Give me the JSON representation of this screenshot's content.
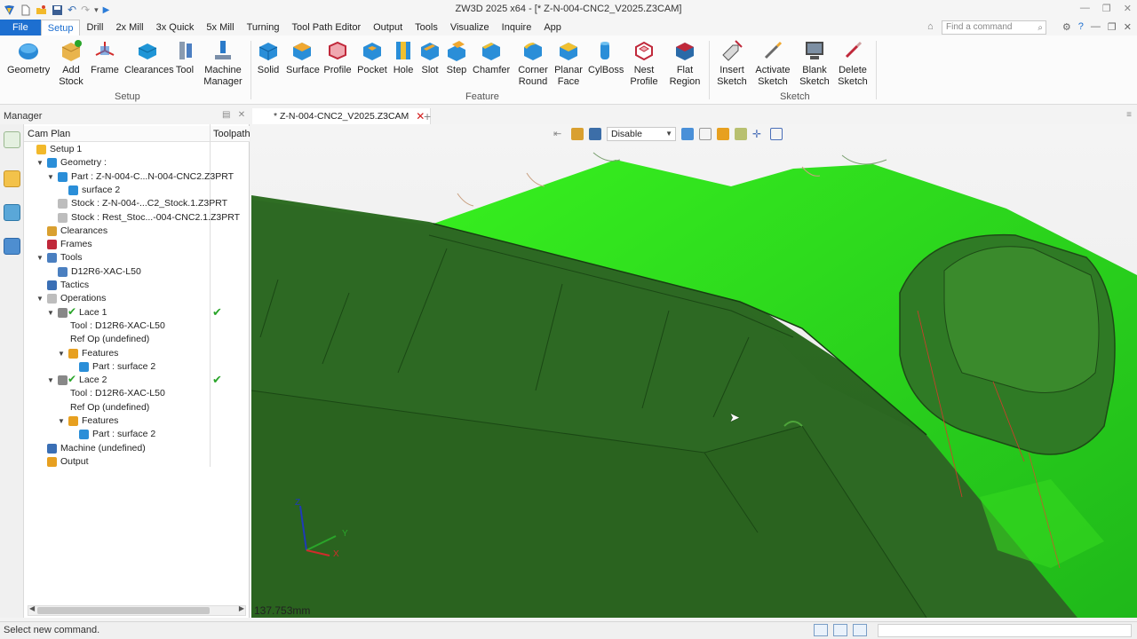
{
  "window": {
    "title": "ZW3D 2025 x64 - [* Z-N-004-CNC2_V2025.Z3CAM]"
  },
  "menubar": {
    "items": [
      "File",
      "Setup",
      "Drill",
      "2x Mill",
      "3x Quick",
      "5x Mill",
      "Turning",
      "Tool Path Editor",
      "Output",
      "Tools",
      "Visualize",
      "Inquire",
      "App"
    ],
    "active": "Setup",
    "search_placeholder": "Find a command"
  },
  "ribbon": {
    "setup_buttons": [
      {
        "label": "Geometry",
        "icon": "geometry-icon"
      },
      {
        "label": "Add\nStock",
        "icon": "add-stock-icon"
      },
      {
        "label": "Frame",
        "icon": "frame-icon"
      },
      {
        "label": "Clearances",
        "icon": "clearances-icon"
      },
      {
        "label": "Tool",
        "icon": "tool-icon"
      },
      {
        "label": "Machine\nManager",
        "icon": "machine-manager-icon"
      }
    ],
    "setup_group": "Setup",
    "feature_buttons": [
      {
        "label": "Solid",
        "icon": "solid-icon"
      },
      {
        "label": "Surface",
        "icon": "surface-icon"
      },
      {
        "label": "Profile",
        "icon": "profile-icon"
      },
      {
        "label": "Pocket",
        "icon": "pocket-icon"
      },
      {
        "label": "Hole",
        "icon": "hole-icon"
      },
      {
        "label": "Slot",
        "icon": "slot-icon"
      },
      {
        "label": "Step",
        "icon": "step-icon"
      },
      {
        "label": "Chamfer",
        "icon": "chamfer-icon"
      },
      {
        "label": "Corner\nRound",
        "icon": "corner-round-icon"
      },
      {
        "label": "Planar\nFace",
        "icon": "planar-face-icon"
      },
      {
        "label": "CylBoss",
        "icon": "cylboss-icon"
      },
      {
        "label": "Nest\nProfile",
        "icon": "nest-profile-icon"
      },
      {
        "label": "Flat\nRegion",
        "icon": "flat-region-icon"
      }
    ],
    "feature_group": "Feature",
    "sketch_buttons": [
      {
        "label": "Insert\nSketch",
        "icon": "insert-sketch-icon"
      },
      {
        "label": "Activate\nSketch",
        "icon": "activate-sketch-icon"
      },
      {
        "label": "Blank\nSketch",
        "icon": "blank-sketch-icon"
      },
      {
        "label": "Delete\nSketch",
        "icon": "delete-sketch-icon"
      }
    ],
    "sketch_group": "Sketch"
  },
  "manager": {
    "title": "Manager",
    "col_camplan": "Cam Plan",
    "col_toolpath": "Toolpath",
    "tree": [
      {
        "label": "Setup 1",
        "icon": "setup-folder-icon",
        "expander": ""
      },
      {
        "label": "Geometry :",
        "icon": "geometry-node-icon",
        "expander": "v"
      },
      {
        "label": "Part : Z-N-004-C...N-004-CNC2.Z3PRT",
        "icon": "part-icon",
        "expander": "v"
      },
      {
        "label": "surface 2",
        "icon": "surface-node-icon",
        "expander": ""
      },
      {
        "label": "Stock : Z-N-004-...C2_Stock.1.Z3PRT",
        "icon": "stock-icon",
        "expander": ""
      },
      {
        "label": "Stock : Rest_Stoc...-004-CNC2.1.Z3PRT",
        "icon": "stock-icon",
        "expander": ""
      },
      {
        "label": "Clearances",
        "icon": "clearances-node-icon",
        "expander": ""
      },
      {
        "label": "Frames",
        "icon": "frames-node-icon",
        "expander": ""
      },
      {
        "label": "Tools",
        "icon": "tools-folder-icon",
        "expander": "v"
      },
      {
        "label": "D12R6-XAC-L50",
        "icon": "tool-node-icon",
        "expander": ""
      },
      {
        "label": "Tactics",
        "icon": "tactics-icon",
        "expander": ""
      },
      {
        "label": "Operations",
        "icon": "operations-folder-icon",
        "expander": "v"
      },
      {
        "label": "Lace 1",
        "icon": "operation-icon",
        "expander": "v",
        "check": "✔"
      },
      {
        "label": "Tool : D12R6-XAC-L50",
        "icon": "",
        "expander": ""
      },
      {
        "label": "Ref Op (undefined)",
        "icon": "",
        "expander": ""
      },
      {
        "label": "Features",
        "icon": "features-icon",
        "expander": "v"
      },
      {
        "label": "Part : surface 2",
        "icon": "surface-node-icon",
        "expander": ""
      },
      {
        "label": "Lace 2",
        "icon": "operation-icon",
        "expander": "v",
        "check": "✔"
      },
      {
        "label": "Tool : D12R6-XAC-L50",
        "icon": "",
        "expander": ""
      },
      {
        "label": "Ref Op (undefined)",
        "icon": "",
        "expander": ""
      },
      {
        "label": "Features",
        "icon": "features-icon",
        "expander": "v"
      },
      {
        "label": "Part : surface 2",
        "icon": "surface-node-icon",
        "expander": ""
      },
      {
        "label": "Machine (undefined)",
        "icon": "machine-node-icon",
        "expander": ""
      },
      {
        "label": "Output",
        "icon": "output-node-icon",
        "expander": ""
      }
    ]
  },
  "document": {
    "tab_label": "* Z-N-004-CNC2_V2025.Z3CAM",
    "add_tab": "+"
  },
  "viewport": {
    "filter_select": "Disable",
    "scale_readout": "137.753mm",
    "axis_labels": {
      "z": "Z",
      "y": "Y",
      "x": "X"
    }
  },
  "status": {
    "text": "Select new command."
  },
  "colors": {
    "accent": "#1d6fd0",
    "toolpath_green": "#3fe82a",
    "model_dark_green": "#2f6e24",
    "check_green": "#2aa52a"
  }
}
